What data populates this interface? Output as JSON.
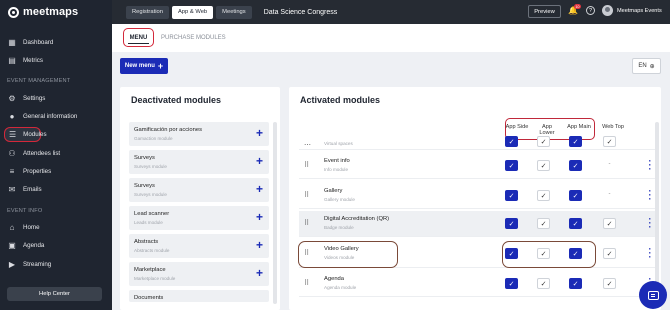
{
  "app": {
    "logo": "meetmaps"
  },
  "sidebar": {
    "items": [
      {
        "label": "Dashboard",
        "icon": "dashboard-icon",
        "glyph": "▦"
      },
      {
        "label": "Metrics",
        "icon": "metrics-icon",
        "glyph": "▤"
      },
      {
        "label": "Settings",
        "icon": "gear-icon",
        "glyph": "⚙"
      },
      {
        "label": "General information",
        "icon": "info-icon",
        "glyph": "●"
      },
      {
        "label": "Modules",
        "icon": "list-icon",
        "glyph": "☰"
      },
      {
        "label": "Attendees list",
        "icon": "people-icon",
        "glyph": "⚇"
      },
      {
        "label": "Properties",
        "icon": "properties-icon",
        "glyph": "≡"
      },
      {
        "label": "Emails",
        "icon": "mail-icon",
        "glyph": "✉"
      },
      {
        "label": "Home",
        "icon": "home-icon",
        "glyph": "⌂"
      },
      {
        "label": "Agenda",
        "icon": "calendar-icon",
        "glyph": "▣"
      },
      {
        "label": "Streaming",
        "icon": "streaming-icon",
        "glyph": "▶"
      }
    ],
    "section_event_management": "EVENT MANAGEMENT",
    "section_event_info": "EVENT INFO",
    "help_center": "Help Center"
  },
  "topbar": {
    "tabs": [
      "Registration",
      "App & Web",
      "Meetings"
    ],
    "active_tab": "App & Web",
    "event_title": "Data Science Congress",
    "preview": "Preview",
    "notification_count": "10",
    "user_name": "Meetmaps Events"
  },
  "subtabs": {
    "menu": "MENU",
    "purchase": "PURCHASE MODULES"
  },
  "actions": {
    "new_menu": "New menu",
    "language": "EN"
  },
  "deactivated": {
    "title": "Deactivated modules",
    "items": [
      {
        "name": "Gamificación por acciones",
        "sub": "Gamaction module"
      },
      {
        "name": "Surveys",
        "sub": "Surveys module"
      },
      {
        "name": "Surveys",
        "sub": "Surveys module"
      },
      {
        "name": "Lead scanner",
        "sub": "Leads module"
      },
      {
        "name": "Abstracts",
        "sub": "Abstracts module"
      },
      {
        "name": "Marketplace",
        "sub": "Marketplace module"
      },
      {
        "name": "Documents",
        "sub": ""
      }
    ]
  },
  "activated": {
    "title": "Activated modules",
    "columns": [
      "App Side",
      "App Lower",
      "App Main",
      "Web Top"
    ],
    "rows": [
      {
        "name": "",
        "sub": "Virtual spaces",
        "checks": [
          "on",
          "off",
          "on",
          "off"
        ],
        "shade": false
      },
      {
        "name": "Event info",
        "sub": "Info module",
        "checks": [
          "on",
          "off",
          "on",
          "dash"
        ],
        "shade": false
      },
      {
        "name": "Gallery",
        "sub": "Gallery module",
        "checks": [
          "on",
          "off",
          "on",
          "dash"
        ],
        "shade": false
      },
      {
        "name": "Digital Accreditation (QR)",
        "sub": "Badge module",
        "checks": [
          "on",
          "off",
          "on",
          "off"
        ],
        "shade": true
      },
      {
        "name": "Video Gallery",
        "sub": "Videos module",
        "checks": [
          "on",
          "off",
          "on",
          "off"
        ],
        "shade": false
      },
      {
        "name": "Agenda",
        "sub": "Agenda module",
        "checks": [
          "on",
          "off",
          "on",
          "off"
        ],
        "shade": false
      }
    ]
  },
  "colors": {
    "accent": "#1b2bb6",
    "highlight": "#d3283a",
    "sidebar": "#1f2530"
  }
}
